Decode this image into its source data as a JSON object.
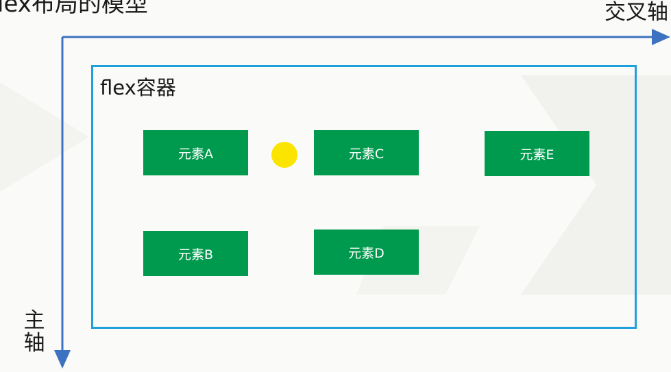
{
  "title": "lex布局的模型",
  "axes": {
    "cross_axis_label": "交叉轴",
    "main_axis_label_line1": "主",
    "main_axis_label_line2": "轴",
    "color": "#3d72c0"
  },
  "container": {
    "label": "flex容器",
    "border_color": "#1fa0dd"
  },
  "items": [
    {
      "label": "元素A"
    },
    {
      "label": "元素B"
    },
    {
      "label": "元素C"
    },
    {
      "label": "元素D"
    },
    {
      "label": "元素E"
    }
  ],
  "colors": {
    "item_fill": "#009a4e",
    "highlight_dot": "#fbe500"
  }
}
